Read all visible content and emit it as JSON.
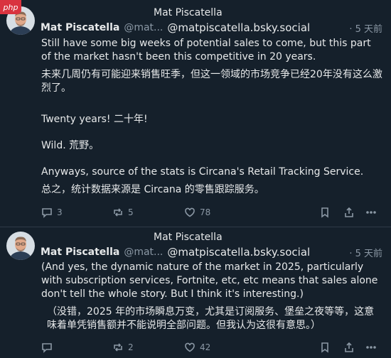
{
  "badge": "php",
  "tweets": [
    {
      "display_name_top": "Mat Piscatella",
      "name": "Mat Piscatella",
      "handle_short": "@mat...",
      "handle_full": "@matpiscatella.bsky.social",
      "time": "· 5 天前",
      "lines": [
        "Still have some big weeks of potential sales to come, but this part of the market hasn't been this competitive in 20 years.",
        "未来几周仍有可能迎来销售旺季，但这一领域的市场竞争已经20年没有这么激烈了。",
        "Twenty years!  二十年!",
        "Wild.  荒野。",
        "Anyways, source of the stats is Circana's Retail Tracking Service.",
        "总之，统计数据来源是 Circana 的零售跟踪服务。"
      ],
      "replies": "3",
      "reposts": "5",
      "likes": "78"
    },
    {
      "display_name_top": "Mat Piscatella",
      "name": "Mat Piscatella",
      "handle_short": "@mat...",
      "handle_full": "@matpiscatella.bsky.social",
      "time": "· 5 天前",
      "lines": [
        "(And yes, the dynamic nature of the market in 2025, particularly with subscription services, Fortnite, etc, etc means that sales alone don't tell the whole story. But I think it's interesting.)",
        "（没错，2025 年的市场瞬息万变，尤其是订阅服务、堡垒之夜等等，这意味着单凭销售额并不能说明全部问题。但我认为这很有意思。）"
      ],
      "replies": "",
      "reposts": "2",
      "likes": "42"
    }
  ],
  "icons": {
    "reply": "speech-bubble-icon",
    "repost": "repost-arrows-icon",
    "like": "heart-icon",
    "bookmark": "bookmark-icon",
    "share": "share-upload-icon",
    "more": "more-dots-icon"
  },
  "colors": {
    "background": "#15202b",
    "text": "#e7e9ea",
    "muted": "#8b98a5"
  }
}
